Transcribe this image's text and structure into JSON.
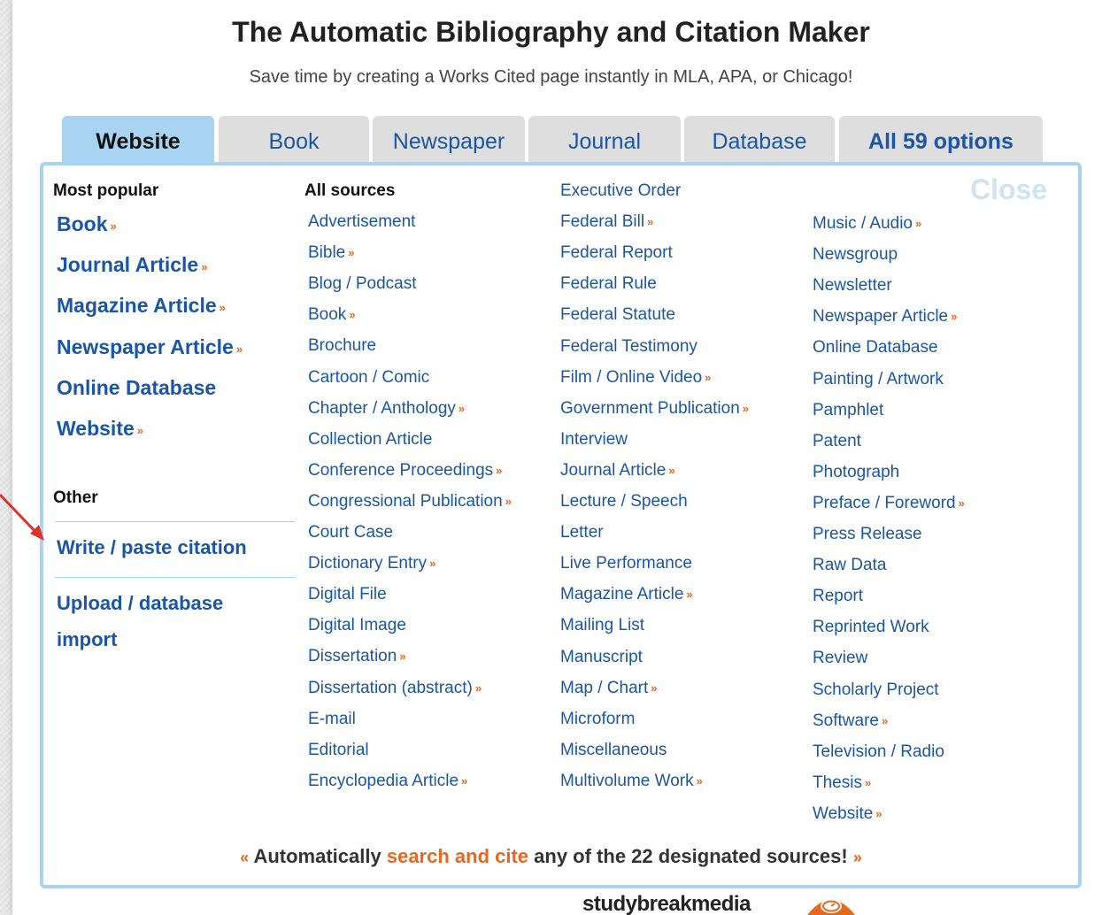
{
  "title": "The Automatic Bibliography and Citation Maker",
  "subtitle": "Save time by creating a Works Cited page instantly in MLA, APA, or Chicago!",
  "tabs": [
    "Website",
    "Book",
    "Newspaper",
    "Journal",
    "Database",
    "All 59 options"
  ],
  "close_label": "Close",
  "popular": {
    "heading": "Most popular",
    "items": [
      {
        "label": "Book",
        "more": "»"
      },
      {
        "label": "Journal Article",
        "more": "»"
      },
      {
        "label": "Magazine Article",
        "more": "»"
      },
      {
        "label": "Newspaper Article",
        "more": "»"
      },
      {
        "label": "Online Database",
        "more": ""
      },
      {
        "label": "Website",
        "more": "»"
      }
    ]
  },
  "other": {
    "heading": "Other",
    "items": [
      "Write / paste citation",
      "Upload / database",
      "import"
    ]
  },
  "all_sources": {
    "heading": "All sources",
    "col1": [
      {
        "label": "Advertisement",
        "more": ""
      },
      {
        "label": "Bible",
        "more": "»"
      },
      {
        "label": "Blog / Podcast",
        "more": ""
      },
      {
        "label": "Book",
        "more": "»"
      },
      {
        "label": "Brochure",
        "more": ""
      },
      {
        "label": "Cartoon / Comic",
        "more": ""
      },
      {
        "label": "Chapter / Anthology",
        "more": "»"
      },
      {
        "label": "Collection Article",
        "more": ""
      },
      {
        "label": "Conference Proceedings",
        "more": "»"
      },
      {
        "label": "Congressional Publication",
        "more": "»"
      },
      {
        "label": "Court Case",
        "more": ""
      },
      {
        "label": "Dictionary Entry",
        "more": "»"
      },
      {
        "label": "Digital File",
        "more": ""
      },
      {
        "label": "Digital Image",
        "more": ""
      },
      {
        "label": "Dissertation",
        "more": "»"
      },
      {
        "label": "Dissertation (abstract)",
        "more": "»"
      },
      {
        "label": "E-mail",
        "more": ""
      },
      {
        "label": "Editorial",
        "more": ""
      },
      {
        "label": "Encyclopedia Article",
        "more": "»"
      }
    ],
    "col2": [
      {
        "label": "Executive Order",
        "more": ""
      },
      {
        "label": "Federal Bill",
        "more": "»"
      },
      {
        "label": "Federal Report",
        "more": ""
      },
      {
        "label": "Federal Rule",
        "more": ""
      },
      {
        "label": "Federal Statute",
        "more": ""
      },
      {
        "label": "Federal Testimony",
        "more": ""
      },
      {
        "label": "Film / Online Video",
        "more": "»"
      },
      {
        "label": "Government Publication",
        "more": "»"
      },
      {
        "label": "Interview",
        "more": ""
      },
      {
        "label": "Journal Article",
        "more": "»"
      },
      {
        "label": "Lecture / Speech",
        "more": ""
      },
      {
        "label": "Letter",
        "more": ""
      },
      {
        "label": "Live Performance",
        "more": ""
      },
      {
        "label": "Magazine Article",
        "more": "»"
      },
      {
        "label": "Mailing List",
        "more": ""
      },
      {
        "label": "Manuscript",
        "more": ""
      },
      {
        "label": "Map / Chart",
        "more": "»"
      },
      {
        "label": "Microform",
        "more": ""
      },
      {
        "label": "Miscellaneous",
        "more": ""
      },
      {
        "label": "Multivolume Work",
        "more": "»"
      }
    ],
    "col3": [
      {
        "label": "Music / Audio",
        "more": "»"
      },
      {
        "label": "Newsgroup",
        "more": ""
      },
      {
        "label": "Newsletter",
        "more": ""
      },
      {
        "label": "Newspaper Article",
        "more": "»"
      },
      {
        "label": "Online Database",
        "more": ""
      },
      {
        "label": "Painting / Artwork",
        "more": ""
      },
      {
        "label": "Pamphlet",
        "more": ""
      },
      {
        "label": "Patent",
        "more": ""
      },
      {
        "label": "Photograph",
        "more": ""
      },
      {
        "label": "Preface / Foreword",
        "more": "»"
      },
      {
        "label": "Press Release",
        "more": ""
      },
      {
        "label": "Raw Data",
        "more": ""
      },
      {
        "label": "Report",
        "more": ""
      },
      {
        "label": "Reprinted Work",
        "more": ""
      },
      {
        "label": "Review",
        "more": ""
      },
      {
        "label": "Scholarly Project",
        "more": ""
      },
      {
        "label": "Software",
        "more": "»"
      },
      {
        "label": "Television / Radio",
        "more": ""
      },
      {
        "label": "Thesis",
        "more": "»"
      },
      {
        "label": "Website",
        "more": "»"
      }
    ]
  },
  "footer": {
    "left_quote": "«",
    "text_a": "Automatically",
    "link": "search and cite",
    "text_b": "any of the 22 designated sources!",
    "right_quote": "»"
  },
  "brand": "studybreakmedia",
  "colors": {
    "accent": "#a8d4f2",
    "link": "#1a56a6",
    "orange": "#e8671d"
  },
  "icons": [
    "arrow-pointer-icon",
    "studybreak-logo-icon"
  ]
}
